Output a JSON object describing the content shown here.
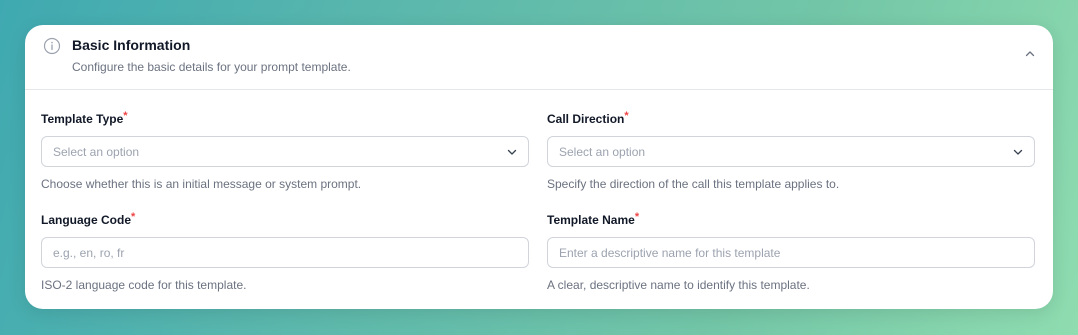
{
  "section": {
    "title": "Basic Information",
    "description": "Configure the basic details for your prompt template.",
    "icon": "info-icon",
    "collapse_icon": "chevron-up-icon"
  },
  "fields": {
    "template_type": {
      "label": "Template Type",
      "required_mark": "*",
      "value": "Select an option",
      "help": "Choose whether this is an initial message or system prompt."
    },
    "call_direction": {
      "label": "Call Direction",
      "required_mark": "*",
      "value": "Select an option",
      "help": "Specify the direction of the call this template applies to."
    },
    "language_code": {
      "label": "Language Code",
      "required_mark": "*",
      "placeholder": "e.g., en, ro, fr",
      "help": "ISO-2 language code for this template."
    },
    "template_name": {
      "label": "Template Name",
      "required_mark": "*",
      "placeholder": "Enter a descriptive name for this template",
      "help": "A clear, descriptive name to identify this template."
    }
  },
  "colors": {
    "required": "#ef4444",
    "text_primary": "#111827",
    "text_muted": "#6b7280",
    "border": "#d1d5db"
  }
}
